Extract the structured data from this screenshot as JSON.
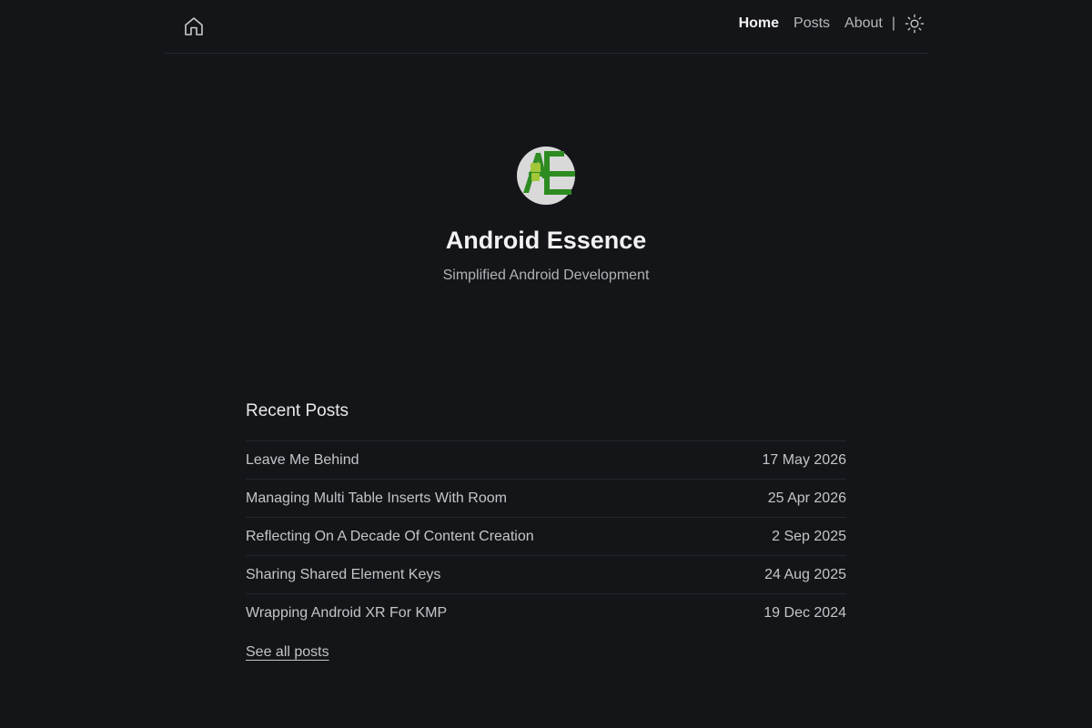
{
  "nav": {
    "home_icon": "home-icon",
    "links": [
      "Home",
      "Posts",
      "About"
    ],
    "separator": "|",
    "theme_icon": "sun-icon"
  },
  "hero": {
    "avatar_icon": "android-essence-logo",
    "title": "Android Essence",
    "tagline": "Simplified Android Development"
  },
  "recent": {
    "title": "Recent Posts",
    "posts": [
      {
        "title": "Leave Me Behind",
        "date": "17 May 2026"
      },
      {
        "title": "Managing Multi Table Inserts With Room",
        "date": "25 Apr 2026"
      },
      {
        "title": "Reflecting On A Decade Of Content Creation",
        "date": "2 Sep 2025"
      },
      {
        "title": "Sharing Shared Element Keys",
        "date": "24 Aug 2025"
      },
      {
        "title": "Wrapping Android XR For KMP",
        "date": "19 Dec 2024"
      }
    ],
    "see_all": "See all posts"
  },
  "colors": {
    "background": "#141519",
    "logo_green": "#2e8b22",
    "logo_bg": "#d9d9d9"
  }
}
